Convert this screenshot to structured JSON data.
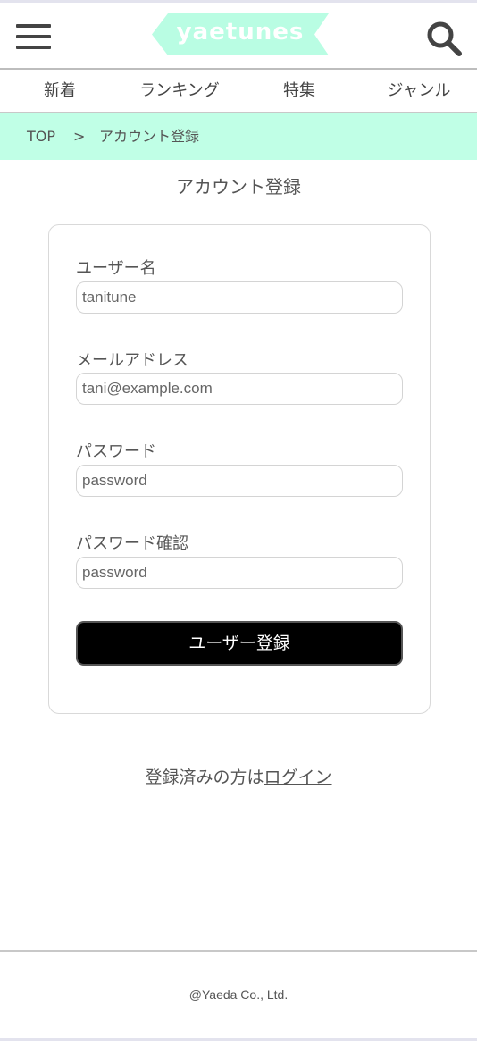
{
  "header": {
    "logo_text": "yaetunes",
    "menu_icon": "hamburger-menu-icon",
    "search_icon": "search-icon",
    "logo_color": "#b9fde3"
  },
  "nav": {
    "items": [
      {
        "label": "新着"
      },
      {
        "label": "ランキング"
      },
      {
        "label": "特集"
      },
      {
        "label": "ジャンル"
      }
    ]
  },
  "breadcrumb": {
    "home": "TOP",
    "separator": ">",
    "current": "アカウント登録",
    "background": "#c0ffe6"
  },
  "page": {
    "title": "アカウント登録"
  },
  "form": {
    "fields": [
      {
        "label": "ユーザー名",
        "placeholder": "tanitune",
        "value": ""
      },
      {
        "label": "メールアドレス",
        "placeholder": "tani@example.com",
        "value": ""
      },
      {
        "label": "パスワード",
        "placeholder": "password",
        "value": ""
      },
      {
        "label": "パスワード確認",
        "placeholder": "password",
        "value": ""
      }
    ],
    "submit_label": "ユーザー登録"
  },
  "login": {
    "prefix": "登録済みの方は",
    "link": "ログイン"
  },
  "footer": {
    "copyright": "@Yaeda Co., Ltd."
  }
}
